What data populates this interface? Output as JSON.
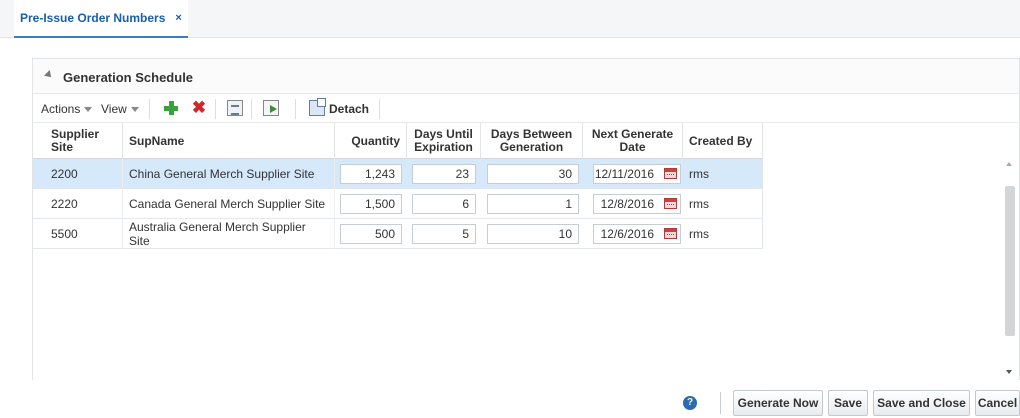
{
  "tab": {
    "label": "Pre-Issue Order Numbers",
    "close": "×"
  },
  "panel": {
    "title": "Generation Schedule"
  },
  "toolbar": {
    "actions_label": "Actions",
    "view_label": "View",
    "detach_label": "Detach"
  },
  "table": {
    "headers": {
      "supplier_site": "Supplier Site",
      "sup_name": "SupName",
      "quantity": "Quantity",
      "days_until_expiration": "Days Until Expiration",
      "days_between_generation": "Days Between Generation",
      "next_generate_date": "Next Generate Date",
      "created_by": "Created By"
    },
    "rows": [
      {
        "supplier_site": "2200",
        "sup_name": "China General Merch Supplier Site",
        "quantity": "1,243",
        "days_until_expiration": "23",
        "days_between_generation": "30",
        "next_generate_date": "12/11/2016",
        "created_by": "rms"
      },
      {
        "supplier_site": "2220",
        "sup_name": "Canada General Merch Supplier Site",
        "quantity": "1,500",
        "days_until_expiration": "6",
        "days_between_generation": "1",
        "next_generate_date": "12/8/2016",
        "created_by": "rms"
      },
      {
        "supplier_site": "5500",
        "sup_name": "Australia General Merch Supplier Site",
        "quantity": "500",
        "days_until_expiration": "5",
        "days_between_generation": "10",
        "next_generate_date": "12/6/2016",
        "created_by": "rms"
      }
    ]
  },
  "footer": {
    "help": "?",
    "generate_now": "Generate Now",
    "save": "Save",
    "save_and_close": "Save and Close",
    "cancel": "Cancel"
  },
  "colors": {
    "accent": "#3b7cc4",
    "selected_row": "#d6e9fb",
    "add": "#39a33b",
    "delete": "#d0272a"
  }
}
